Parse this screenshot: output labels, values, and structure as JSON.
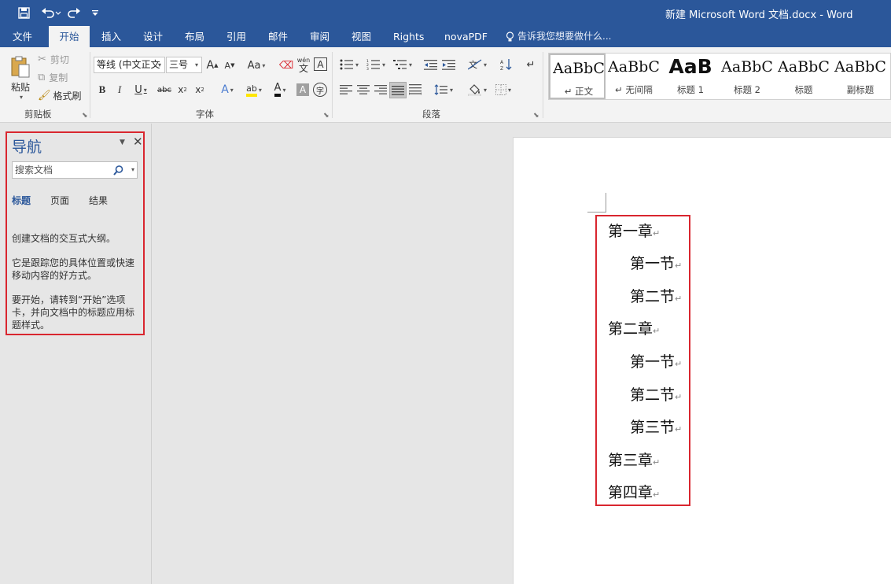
{
  "titlebar": {
    "title": "新建 Microsoft Word 文档.docx - Word",
    "qat": [
      {
        "name": "save",
        "icon": "save-icon"
      },
      {
        "name": "undo",
        "icon": "undo-icon"
      },
      {
        "name": "redo",
        "icon": "redo-icon"
      },
      {
        "name": "customize",
        "icon": "customize-icon"
      }
    ]
  },
  "tabs": [
    "文件",
    "开始",
    "插入",
    "设计",
    "布局",
    "引用",
    "邮件",
    "审阅",
    "视图",
    "Rights",
    "novaPDF"
  ],
  "active_tab": "开始",
  "tell_me": "告诉我您想要做什么...",
  "ribbon": {
    "clipboard": {
      "label": "剪贴板",
      "paste": "粘贴",
      "cut": "剪切",
      "copy": "复制",
      "format_painter": "格式刷"
    },
    "font": {
      "label": "字体",
      "font_name": "等线 (中文正文",
      "font_size": "三号",
      "grow": "A",
      "shrink": "A",
      "change_case": "Aa",
      "phonetic": "wén",
      "phonetic_char": "文",
      "bold": "B",
      "italic": "I",
      "underline": "U",
      "strike": "abc",
      "subscript": "x",
      "superscript": "x",
      "text_effects": "A",
      "highlight": "ab",
      "font_color": "A",
      "char_shading": "A",
      "enclose": "字"
    },
    "paragraph": {
      "label": "段落"
    },
    "styles": [
      {
        "preview": "AaBbC",
        "name": "↵ 正文",
        "selected": true
      },
      {
        "preview": "AaBbC",
        "name": "↵ 无间隔",
        "selected": false
      },
      {
        "preview": "AaB",
        "name": "标题 1",
        "selected": false
      },
      {
        "preview": "AaBbC",
        "name": "标题 2",
        "selected": false
      },
      {
        "preview": "AaBbC",
        "name": "标题",
        "selected": false
      },
      {
        "preview": "AaBbC",
        "name": "副标题",
        "selected": false
      }
    ]
  },
  "navigation": {
    "title": "导航",
    "search_placeholder": "搜索文档",
    "tabs": [
      "标题",
      "页面",
      "结果"
    ],
    "active_tab": "标题",
    "help_1": "创建文档的交互式大纲。",
    "help_2": "它是跟踪您的具体位置或快速移动内容的好方式。",
    "help_3": "要开始，请转到“开始”选项卡，并向文档中的标题应用标题样式。"
  },
  "document": {
    "paragraph_mark": "↵",
    "paragraphs": [
      {
        "text": "第一章",
        "level": 1
      },
      {
        "text": "第一节",
        "level": 2
      },
      {
        "text": "第二节",
        "level": 2
      },
      {
        "text": "第二章",
        "level": 1
      },
      {
        "text": "第一节",
        "level": 2
      },
      {
        "text": "第二节",
        "level": 2
      },
      {
        "text": "第三节",
        "level": 2
      },
      {
        "text": "第三章",
        "level": 1
      },
      {
        "text": "第四章",
        "level": 1
      }
    ]
  },
  "colors": {
    "accent": "#2b579a",
    "highlight_frame": "#d9262f"
  }
}
